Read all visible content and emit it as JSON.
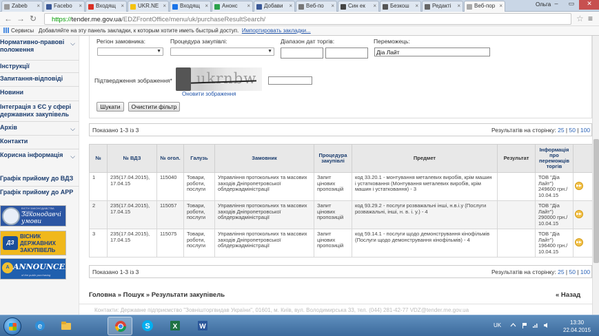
{
  "browser": {
    "tabs": [
      {
        "label": "Zabeb",
        "color": "#9a9a9a"
      },
      {
        "label": "Facebo",
        "color": "#3b5998"
      },
      {
        "label": "Входящ",
        "color": "#d93025"
      },
      {
        "label": "UKR.NE",
        "color": "#f4c20d"
      },
      {
        "label": "Входящ",
        "color": "#1a73e8"
      },
      {
        "label": "Анонс",
        "color": "#2ba24c"
      },
      {
        "label": "Добави",
        "color": "#3b5998"
      },
      {
        "label": "Веб-по",
        "color": "#777777"
      },
      {
        "label": "Син ек",
        "color": "#444444"
      },
      {
        "label": "Безкош",
        "color": "#555555"
      },
      {
        "label": "Редакті",
        "color": "#666666"
      },
      {
        "label": "Веб-пор",
        "color": "#aaaaaa"
      }
    ],
    "user": "Ольга",
    "url": {
      "protocol": "https://",
      "host": "tender.me.gov.ua",
      "path": "/EDZFrontOffice/menu/uk/purchaseResultSearch/"
    },
    "bookmarks": {
      "apps": "Сервисы",
      "hint": "Добавляйте на эту панель закладки, к которым хотите иметь быстрый доступ.",
      "import": "Импортировать закладки..."
    }
  },
  "sidebar": {
    "items": [
      {
        "label": "Нормативно-правові положення",
        "chevron": true
      },
      {
        "label": "Інструкції",
        "chevron": false
      },
      {
        "label": "Запитання-відповіді",
        "chevron": false
      },
      {
        "label": "Новини",
        "chevron": false
      },
      {
        "label": "Інтеграція з ЄС у сфері державних закупівель",
        "chevron": false
      },
      {
        "label": "Архів",
        "chevron": true
      },
      {
        "label": "Контакти",
        "chevron": false
      },
      {
        "label": "Корисна інформація",
        "chevron": true
      },
      {
        "label": "Графік прийому до ВДЗ",
        "chevron": false
      },
      {
        "label": "Графік прийому до АРР",
        "chevron": false
      }
    ],
    "banners": {
      "vdz": {
        "script": "Законодавчі умови",
        "header": "ВІСТИ ЗАКОНОДАВСТВА УКРАЇНИ"
      },
      "visnyk": {
        "logo": "ДЗ",
        "line1": "ВІСНИК",
        "line2": "ДЕРЖАВНИХ",
        "line3": "ЗАКУПІВЕЛЬ"
      },
      "announcer": {
        "logo": "A",
        "title": "ANNOUNCER",
        "sub": "of the public purchasing"
      }
    }
  },
  "filter": {
    "region_label": "Регіон замовника:",
    "procedure_label": "Процедура закупівлі:",
    "dates_label": "Діапазон дат торгів:",
    "winner_label": "Переможець:",
    "winner_value": "Діа Лайт",
    "captcha_label": "Підтвердження зображення*",
    "captcha_word": "ukrnbw",
    "refresh_label": "Оновити зображення",
    "search_button": "Шукати",
    "clear_button": "Очистити фільтр"
  },
  "results_bar": {
    "count": "Показано 1-3 із 3",
    "per_page_label": "Результатів на сторінку:",
    "options": [
      "25",
      "50",
      "100"
    ]
  },
  "table": {
    "headers": [
      "№",
      "№ ВДЗ",
      "№ огол.",
      "Галузь",
      "Замовник",
      "Процедура закупівлі",
      "Предмет",
      "Результат",
      "Інформація про переможців торгів"
    ],
    "rows": [
      {
        "n": "1",
        "vdz": "235(17.04.2015), 17.04.15",
        "ogol": "115040",
        "galuz": "Товари, роботи, послуги",
        "customer": "Управління протокольних та масових заходів Дніпропетровської облдержадміністрації",
        "procedure": "Запит цінових пропозицій",
        "subject": "код 33.20.1 - монтування металевих виробів, крім машин і устатковання (Монтування металевих виробів, крім машин і устатковання) - 3",
        "result": "",
        "winner": "ТОВ \"Діа Лайт\") 249600 грн./ 10.04.15"
      },
      {
        "n": "2",
        "vdz": "235(17.04.2015), 17.04.15",
        "ogol": "115057",
        "galuz": "Товари, роботи, послуги",
        "customer": "Управління протокольних та масових заходів Дніпропетровської облдержадміністрації",
        "procedure": "Запит цінових пропозицій",
        "subject": "код 93.29.2 - послуги розважальні інші, н.в.і.у (Послуги розважальні, інші, н. в. і. у.) - 4",
        "result": "",
        "winner": "ТОВ \"Діа Лайт\") 290000 грн./ 10.04.15"
      },
      {
        "n": "3",
        "vdz": "235(17.04.2015), 17.04.15",
        "ogol": "115075",
        "galuz": "Товари, роботи, послуги",
        "customer": "Управління протокольних та масових заходів Дніпропетровської облдержадміністрації",
        "procedure": "Запит цінових пропозицій",
        "subject": "код 59.14.1 - послуги щодо демонстрування кінофільмів (Послуги щодо демонстрування кінофільмів) - 4",
        "result": "",
        "winner": "ТОВ \"Діа Лайт\") 196400 грн./ 10.04.15"
      }
    ]
  },
  "breadcrumb": "Головна » Пошук » Результати закупівель",
  "back_link": "« Назад",
  "footer": "Контакти: Державне підприємство \"Зовнішторгвидав України\", 01601, м. Київ, вул. Володимирська 33, тел. (044) 281-42-77 VDZ@tender.me.gov.ua",
  "taskbar": {
    "lang": "UK",
    "time": "13:30",
    "date": "22.04.2015"
  }
}
